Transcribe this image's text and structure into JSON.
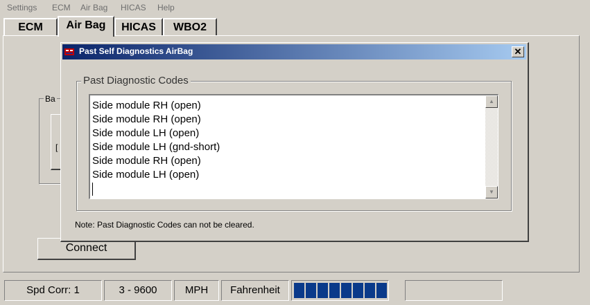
{
  "menu": [
    "Settings",
    "ECM",
    "Air Bag",
    "HICAS",
    "Help"
  ],
  "tabs": [
    "ECM",
    "Air Bag",
    "HICAS",
    "WBO2"
  ],
  "active_tab": "Air Bag",
  "background_group": {
    "label": "Ba",
    "inner_text": "["
  },
  "connect_button": "Connect",
  "dialog": {
    "title": "Past Self Diagnostics AirBag",
    "close_glyph": "✕",
    "group_label": "Past Diagnostic Codes",
    "codes": [
      "Side module RH (open)",
      "Side module RH (open)",
      "Side module LH (open)",
      "Side module LH (gnd-short)",
      "Side module RH (open)",
      "Side module LH (open)"
    ],
    "note": "Note: Past Diagnostic Codes can not be cleared."
  },
  "status": {
    "speed_correction": "Spd Corr: 1",
    "baud": "3 - 9600",
    "speed_unit": "MPH",
    "temp_unit": "Fahrenheit",
    "activity_segments": 8,
    "empty_panel": ""
  },
  "colors": {
    "titlebar_start": "#0a246a",
    "titlebar_end": "#a6caf0",
    "activity_segment": "#0a3a8a",
    "face": "#d4d0c8"
  },
  "icons": {
    "title_icon": "app-icon",
    "close": "close-icon",
    "scroll_up": "arrow-up-icon",
    "scroll_down": "arrow-down-icon"
  }
}
